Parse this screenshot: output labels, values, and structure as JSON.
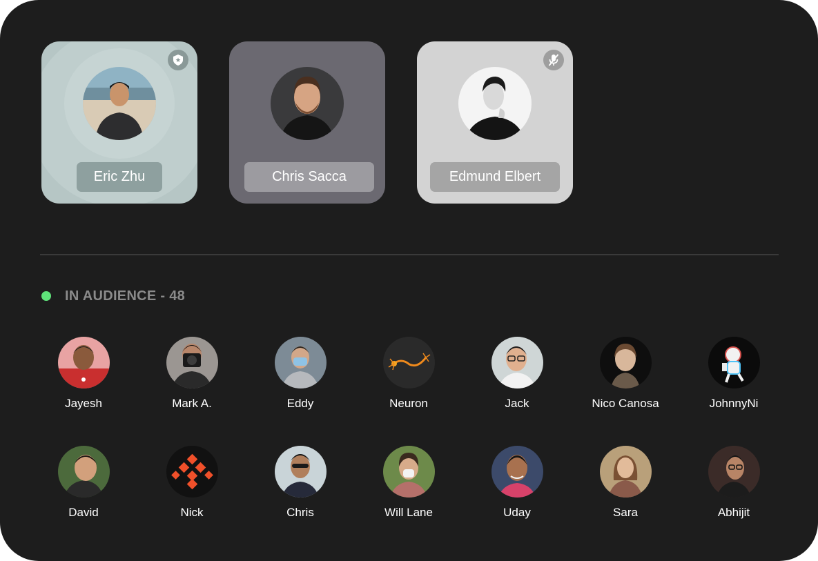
{
  "speakers": [
    {
      "name": "Eric Zhu",
      "badge_icon": "shield-star-icon",
      "color": "#b6c6c5"
    },
    {
      "name": "Chris Sacca",
      "badge_icon": null,
      "color": "#6b6971"
    },
    {
      "name": "Edmund Elbert",
      "badge_icon": "muted-microphone-icon",
      "color": "#d3d3d3"
    }
  ],
  "audience": {
    "title": "IN AUDIENCE - 48",
    "status_color": "#5fe27a",
    "members": [
      {
        "name": "Jayesh"
      },
      {
        "name": "Mark A."
      },
      {
        "name": "Eddy"
      },
      {
        "name": "Neuron"
      },
      {
        "name": "Jack"
      },
      {
        "name": "Nico Canosa"
      },
      {
        "name": "JohnnyNi"
      },
      {
        "name": "David"
      },
      {
        "name": "Nick"
      },
      {
        "name": "Chris"
      },
      {
        "name": "Will Lane"
      },
      {
        "name": "Uday"
      },
      {
        "name": "Sara"
      },
      {
        "name": "Abhijit"
      }
    ]
  }
}
